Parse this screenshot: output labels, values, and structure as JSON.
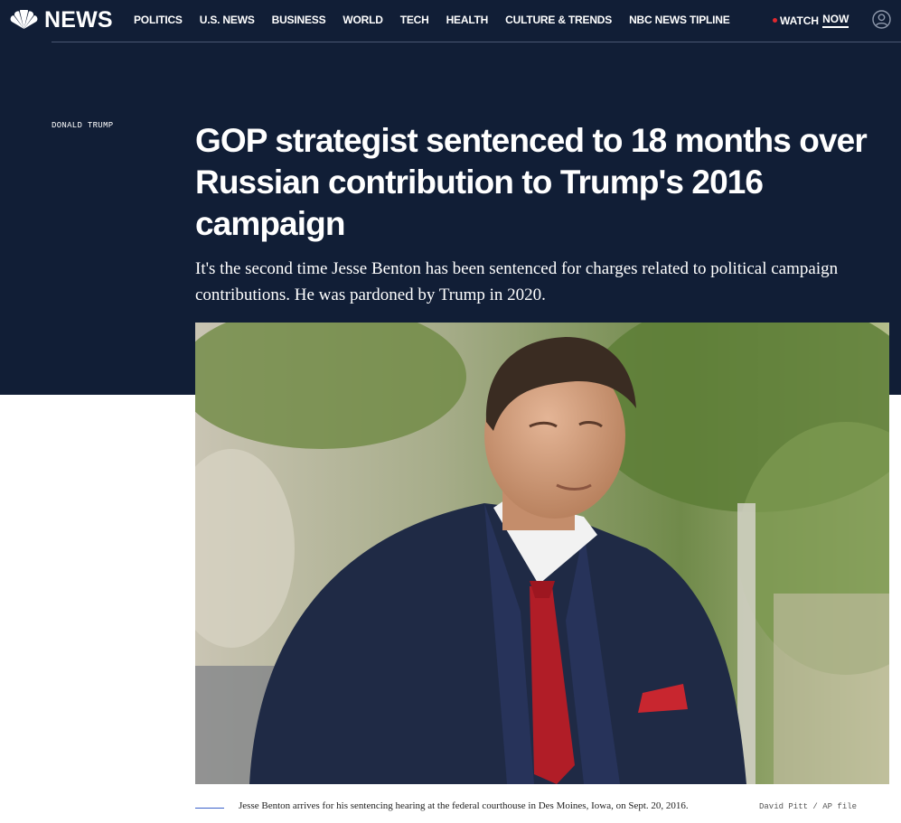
{
  "brand": {
    "name": "NEWS"
  },
  "nav": {
    "items": [
      "POLITICS",
      "U.S. NEWS",
      "BUSINESS",
      "WORLD",
      "TECH",
      "HEALTH",
      "CULTURE & TRENDS",
      "NBC NEWS TIPLINE"
    ],
    "watch_label": "WATCH",
    "watch_now": "NOW"
  },
  "article": {
    "eyebrow": "DONALD TRUMP",
    "headline": "GOP strategist sentenced to 18 months over Russian contribution to Trump's 2016 campaign",
    "dek": "It's the second time Jesse Benton has been sentenced for charges related to political campaign contributions. He was pardoned by Trump in 2020.",
    "caption": "Jesse Benton arrives for his sentencing hearing at the federal courthouse in Des Moines, Iowa, on Sept. 20, 2016.",
    "credit": "David Pitt / AP file"
  },
  "colors": {
    "hero_bg": "#111e36",
    "accent_red": "#e0282e",
    "caption_rule": "#3a61c9"
  },
  "icons": {
    "logo": "nbc-peacock-icon",
    "account": "user-account-icon",
    "live": "live-dot-icon"
  }
}
